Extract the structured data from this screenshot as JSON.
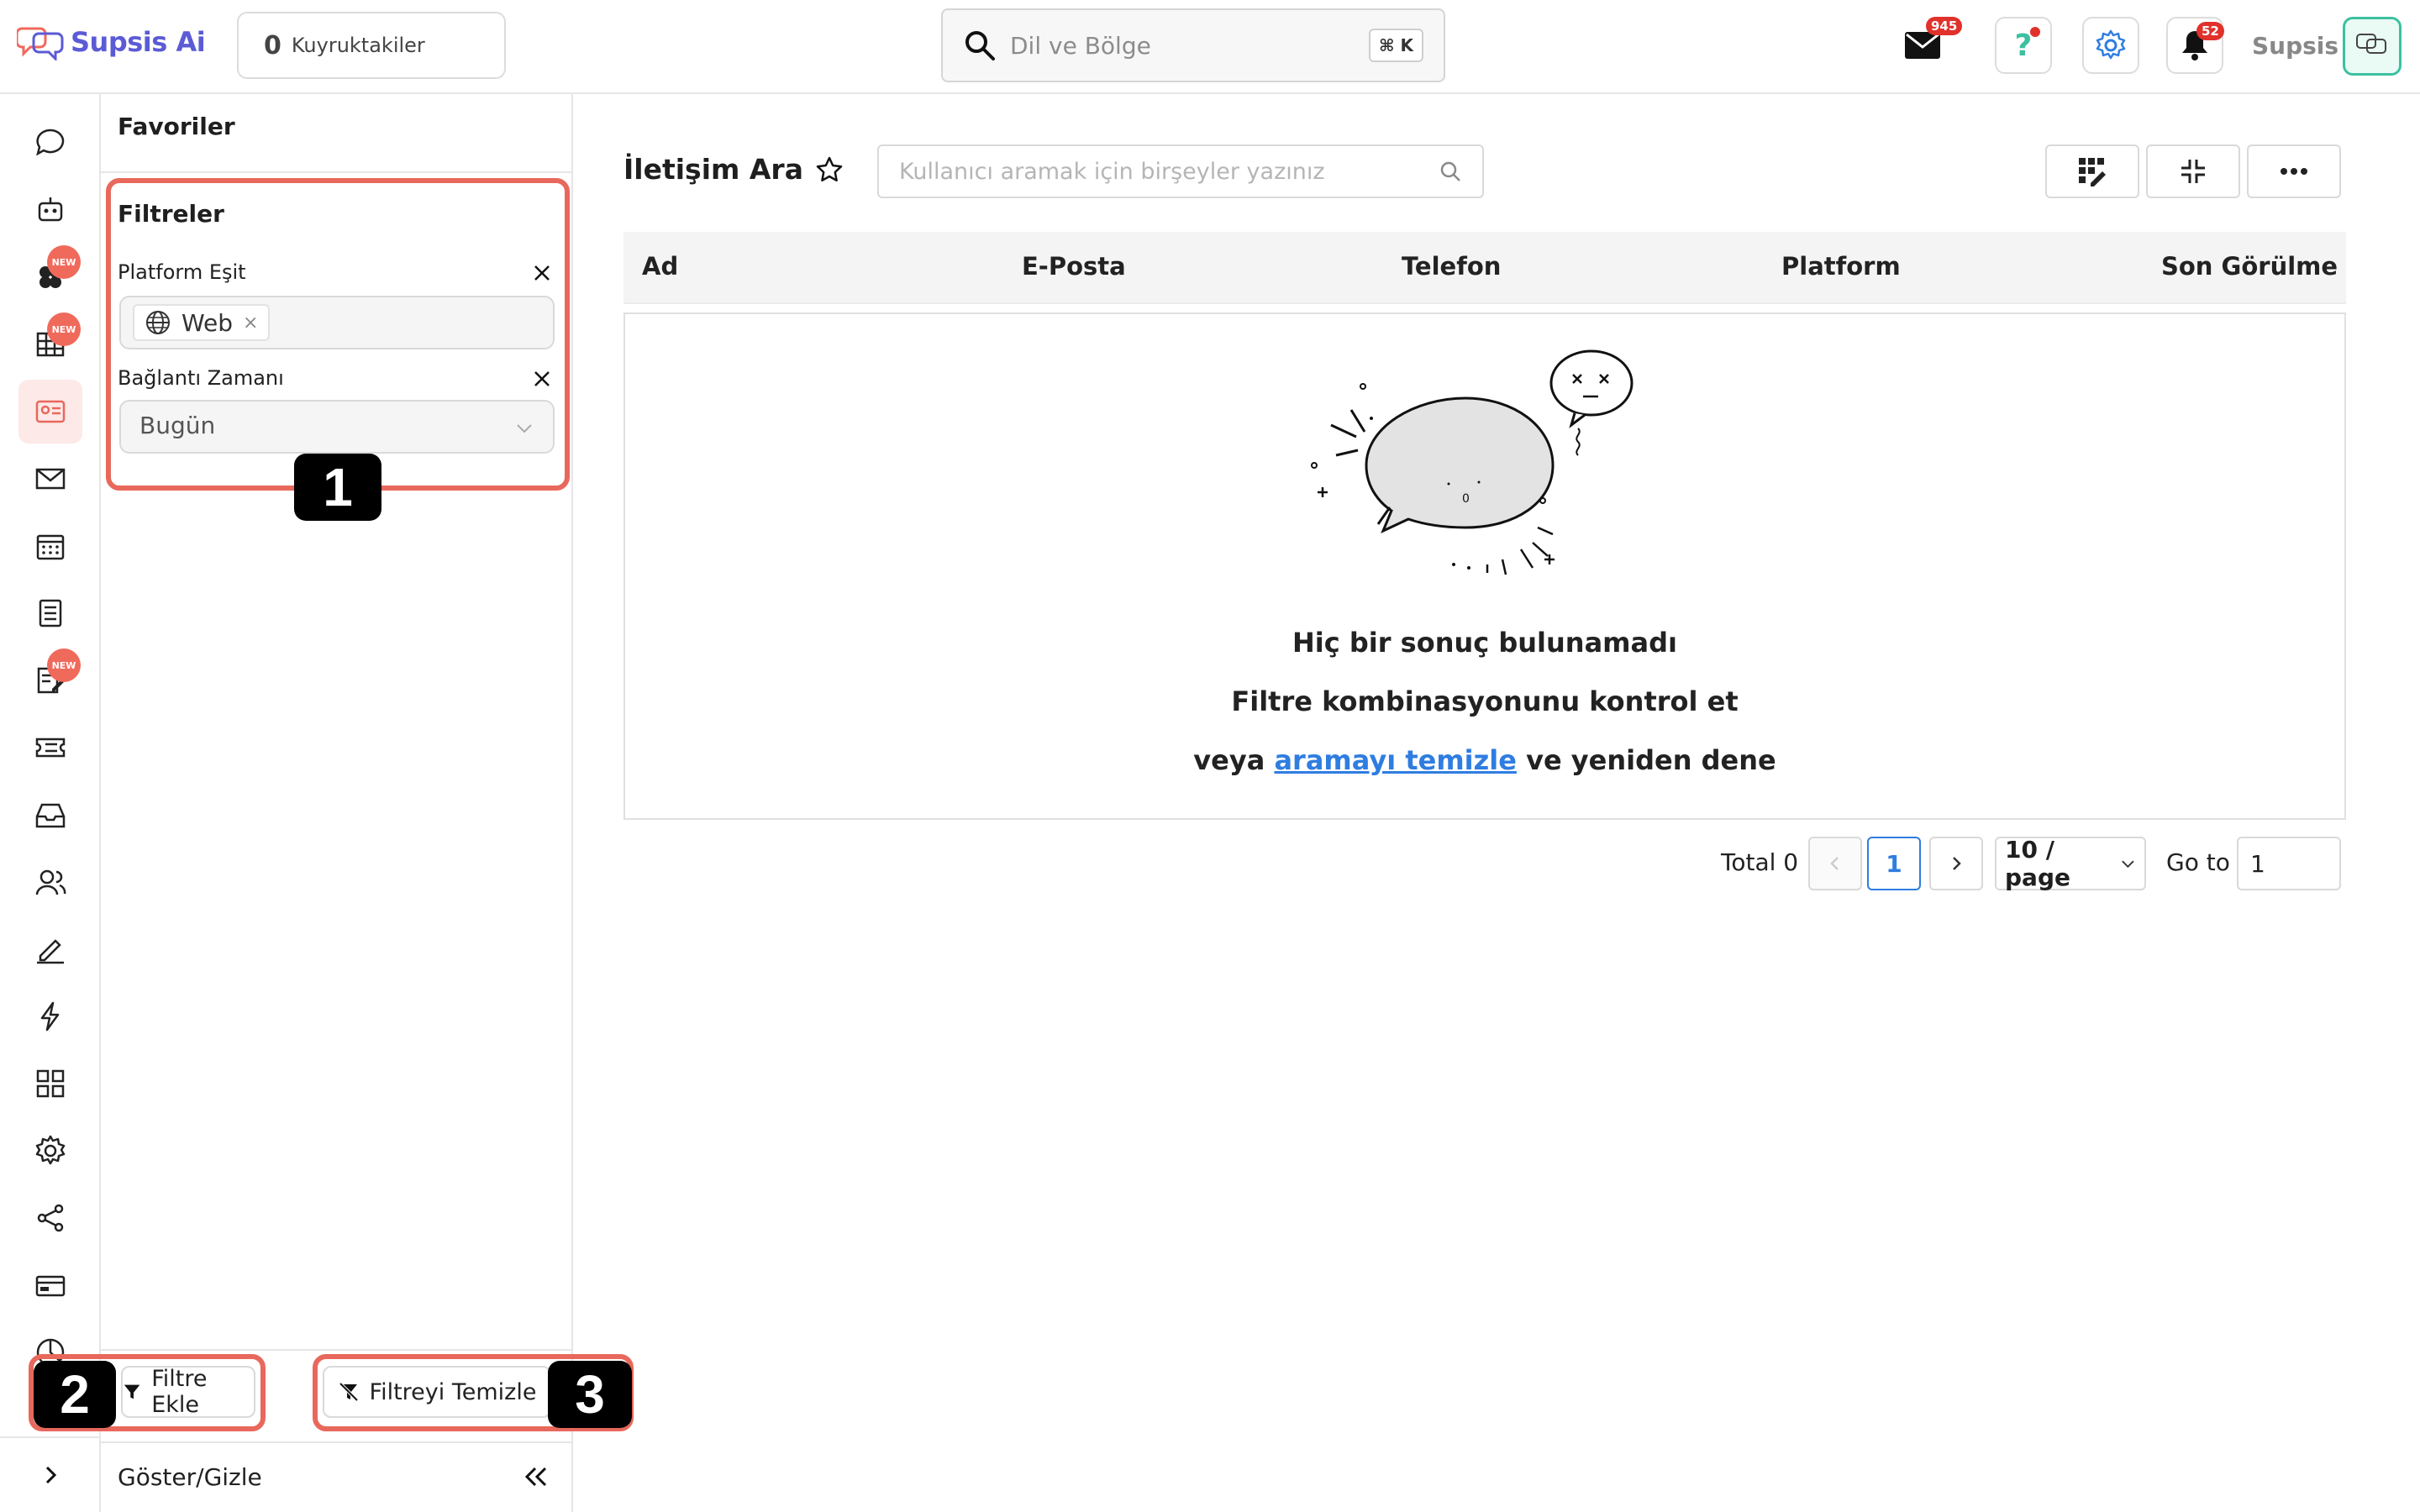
{
  "header": {
    "logo_text": "Supsis Ai",
    "queue_count": "0",
    "queue_label": "Kuyruktakiler",
    "search_placeholder": "Dil ve Bölge",
    "search_shortcut": "⌘ K",
    "mail_badge": "945",
    "notification_badge": "52",
    "user_name": "Supsis"
  },
  "rail": {
    "items": [
      {
        "icon": "chat-bubble-icon"
      },
      {
        "icon": "robot-icon"
      },
      {
        "icon": "flower-icon",
        "tag": "NEW"
      },
      {
        "icon": "table-icon",
        "tag": "NEW"
      },
      {
        "icon": "contact-card-icon",
        "active": true
      },
      {
        "icon": "mail-icon"
      },
      {
        "icon": "calendar-icon"
      },
      {
        "icon": "list-icon"
      },
      {
        "icon": "form-edit-icon",
        "tag": "NEW"
      },
      {
        "icon": "ticket-icon"
      },
      {
        "icon": "inbox-icon"
      },
      {
        "icon": "users-icon"
      },
      {
        "icon": "signature-icon"
      },
      {
        "icon": "lightning-icon"
      },
      {
        "icon": "apps-grid-icon"
      },
      {
        "icon": "settings-gear-icon"
      },
      {
        "icon": "share-icon"
      },
      {
        "icon": "billing-icon"
      },
      {
        "icon": "pie-chart-icon"
      }
    ]
  },
  "panel": {
    "favorites_title": "Favoriler",
    "filters_title": "Filtreler",
    "filter1_label": "Platform Eşit",
    "filter1_chip": "Web",
    "filter2_label": "Bağlantı Zamanı",
    "filter2_value": "Bugün",
    "add_filter": "Filtre Ekle",
    "clear_filter": "Filtreyi Temizle",
    "toggle_label": "Göster/Gizle"
  },
  "annotations": {
    "one": "1",
    "two": "2",
    "three": "3"
  },
  "main": {
    "title": "İletişim Ara",
    "search_placeholder": "Kullanıcı aramak için birşeyler yazınız",
    "columns": [
      "Ad",
      "E-Posta",
      "Telefon",
      "Platform",
      "Son Görülme"
    ],
    "empty_title": "Hiç bir sonuç bulunamadı",
    "empty_hint": "Filtre kombinasyonunu kontrol et",
    "empty_prefix": "veya",
    "empty_link": "aramayı temizle",
    "empty_suffix": "ve yeniden dene"
  },
  "pagination": {
    "total": "Total 0",
    "current_page": "1",
    "page_size": "10 / page",
    "goto_label": "Go to",
    "goto_value": "1"
  },
  "colors": {
    "accent": "#e8685c",
    "link": "#2f7de1",
    "brand": "#5b5bd6"
  }
}
